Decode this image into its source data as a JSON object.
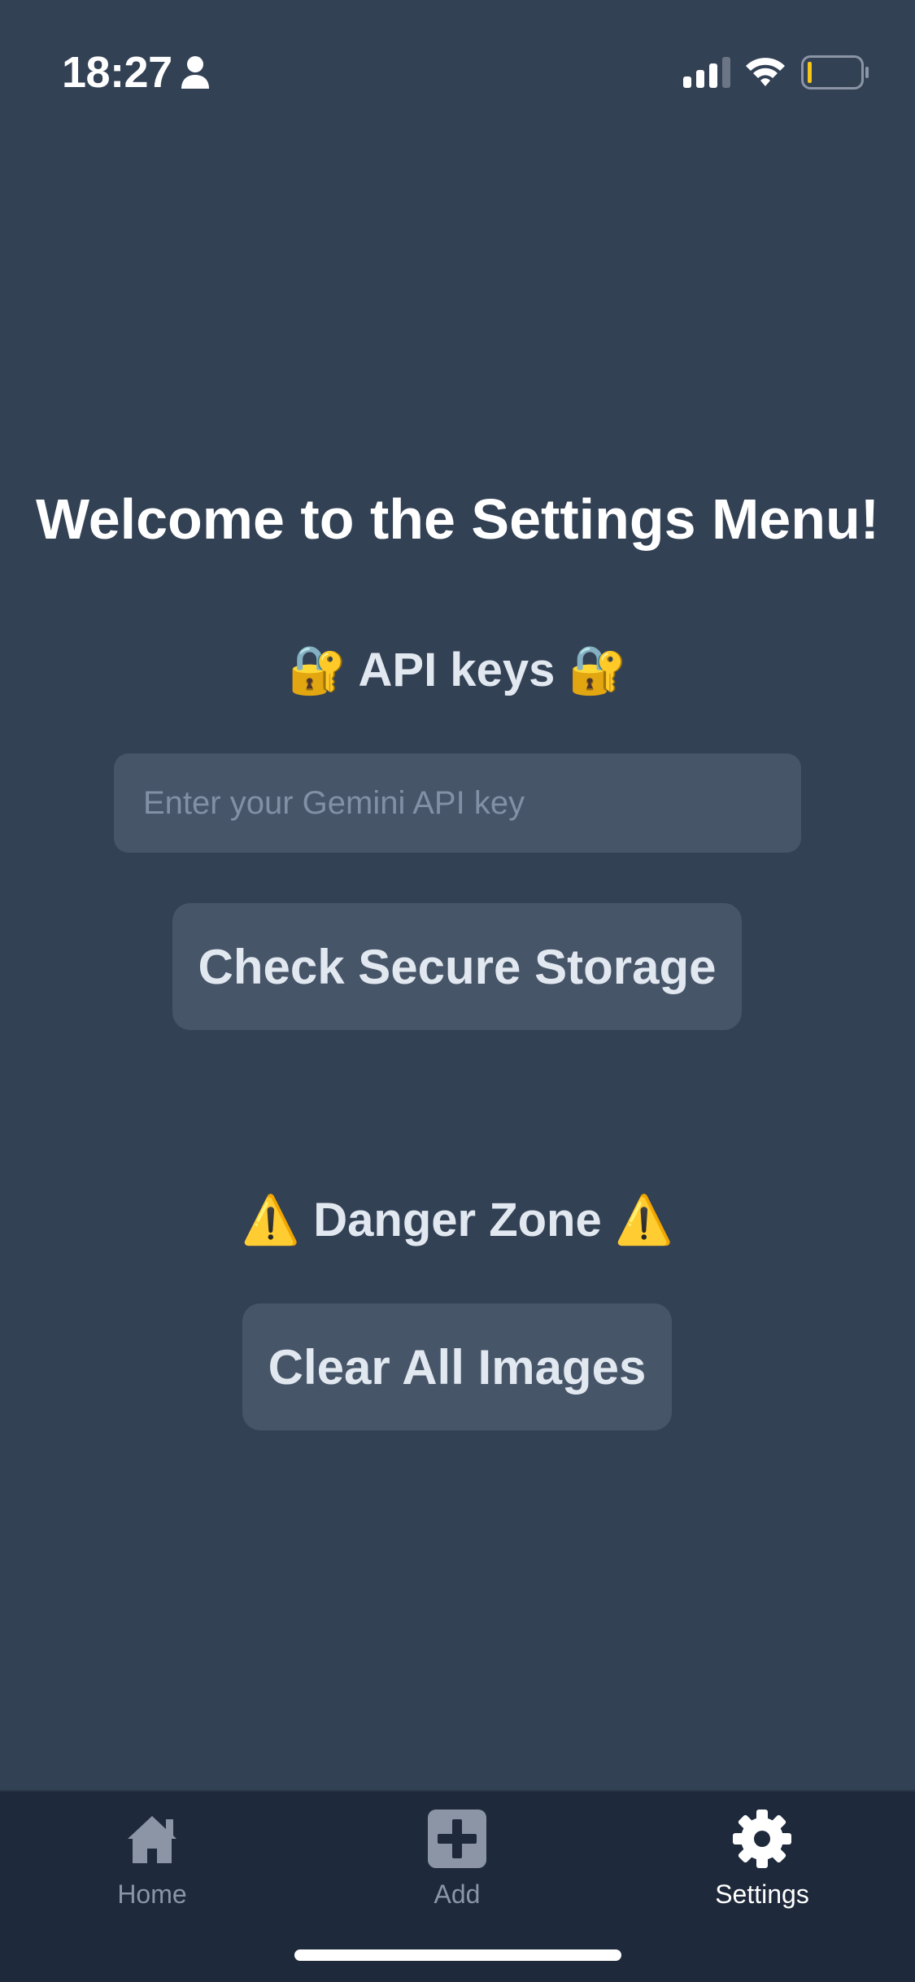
{
  "status_bar": {
    "time": "18:27",
    "person_icon": "person-icon",
    "signal_icon": "cellular-signal-icon",
    "wifi_icon": "wifi-icon",
    "battery_icon": "battery-low-icon",
    "battery_level": 0.08,
    "battery_color": "#f5c518"
  },
  "main": {
    "title": "Welcome to the Settings Menu!",
    "api_section": {
      "heading": "🔐 API keys 🔐",
      "input_placeholder": "Enter your Gemini API key",
      "input_value": "",
      "check_button_label": "Check Secure Storage"
    },
    "danger_section": {
      "heading": "⚠️ Danger Zone ⚠️",
      "clear_button_label": "Clear All Images"
    }
  },
  "tab_bar": {
    "tabs": [
      {
        "label": "Home",
        "icon": "home-icon",
        "active": false
      },
      {
        "label": "Add",
        "icon": "add-icon",
        "active": false
      },
      {
        "label": "Settings",
        "icon": "gear-icon",
        "active": true
      }
    ]
  },
  "colors": {
    "background": "#334155",
    "surface": "#475569",
    "tab_bar": "#1e293b",
    "text": "#e2e8f0",
    "inactive_tab": "#8b95a5",
    "active_tab": "#ffffff"
  }
}
